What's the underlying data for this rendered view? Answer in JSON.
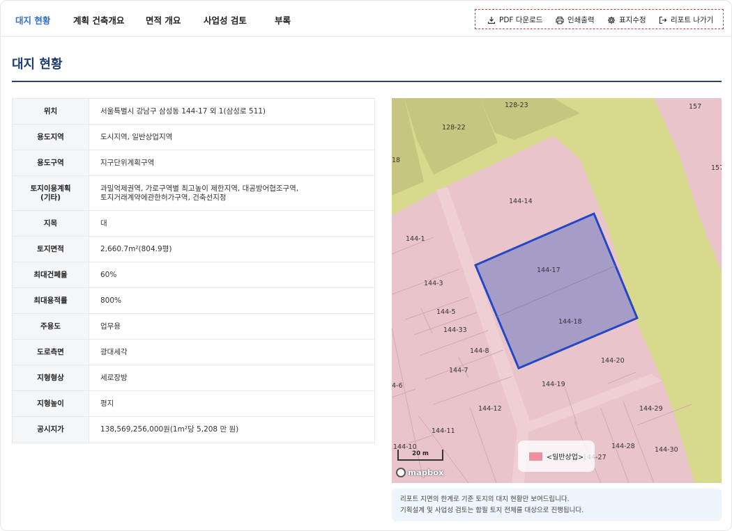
{
  "tabs": [
    {
      "label": "대지 현황",
      "active": true
    },
    {
      "label": "계획 건축개요",
      "active": false
    },
    {
      "label": "면적 개요",
      "active": false
    },
    {
      "label": "사업성 검토",
      "active": false
    },
    {
      "label": "부록",
      "active": false
    }
  ],
  "actions": {
    "pdf": {
      "label": "PDF 다운로드",
      "icon": "download-icon"
    },
    "print": {
      "label": "인쇄출력",
      "icon": "printer-icon"
    },
    "edit_cover": {
      "label": "표지수정",
      "icon": "gear-icon"
    },
    "exit": {
      "label": "리포트 나가기",
      "icon": "exit-icon"
    }
  },
  "page": {
    "title": "대지 현황"
  },
  "site_info": [
    {
      "label": "위치",
      "value": "서울특별시 강남구 삼성동 144-17 외 1(삼성로 511)"
    },
    {
      "label": "용도지역",
      "value": "도시지역, 일반상업지역"
    },
    {
      "label": "용도구역",
      "value": "지구단위계획구역"
    },
    {
      "label": "토지이용계획\n(기타)",
      "value": "과밀억제권역, 가로구역별 최고높이 제한지역, 대공방어협조구역,\n토지거래계약에관한허가구역, 건축선지정"
    },
    {
      "label": "지목",
      "value": "대"
    },
    {
      "label": "토지면적",
      "value": "2,660.7m²(804.9평)"
    },
    {
      "label": "최대건폐율",
      "value": "60%"
    },
    {
      "label": "최대용적률",
      "value": "800%"
    },
    {
      "label": "주용도",
      "value": "업무용"
    },
    {
      "label": "도로측면",
      "value": "광대세각"
    },
    {
      "label": "지형형상",
      "value": "세로장방"
    },
    {
      "label": "지형높이",
      "value": "평지"
    },
    {
      "label": "공시지가",
      "value": "138,569,256,000원(1m²당 5,208 만 원)"
    }
  ],
  "map": {
    "parcel_labels": [
      "128-23",
      "128-22",
      "157",
      "157",
      "18",
      "144-14",
      "144-1",
      "144-17",
      "144-3",
      "144-5",
      "144-18",
      "144-33",
      "144-8",
      "144-20",
      "144-7",
      "144-19",
      "4-6",
      "144-12",
      "144-29",
      "144-11",
      "144-28",
      "144-30",
      "144-10",
      "144-27"
    ],
    "legend_label": "<일반상업>",
    "legend_color": "#ef8fa2",
    "scale_label": "20 m",
    "attribution": "mapbox",
    "colors": {
      "commercial": "#e9c4cb",
      "green_zone": "#d7d98d",
      "selected_fill": "#a59dc7",
      "selected_border": "#2447c4",
      "road": "#f0cfd4"
    }
  },
  "note": {
    "line1": "리포트 지면의 한계로 기준 토지의 대지 현황만 보여드립니다.",
    "line2": "기획설계 및 사업성 검토는 합필 토지 전체를 대상으로 진행됩니다."
  }
}
